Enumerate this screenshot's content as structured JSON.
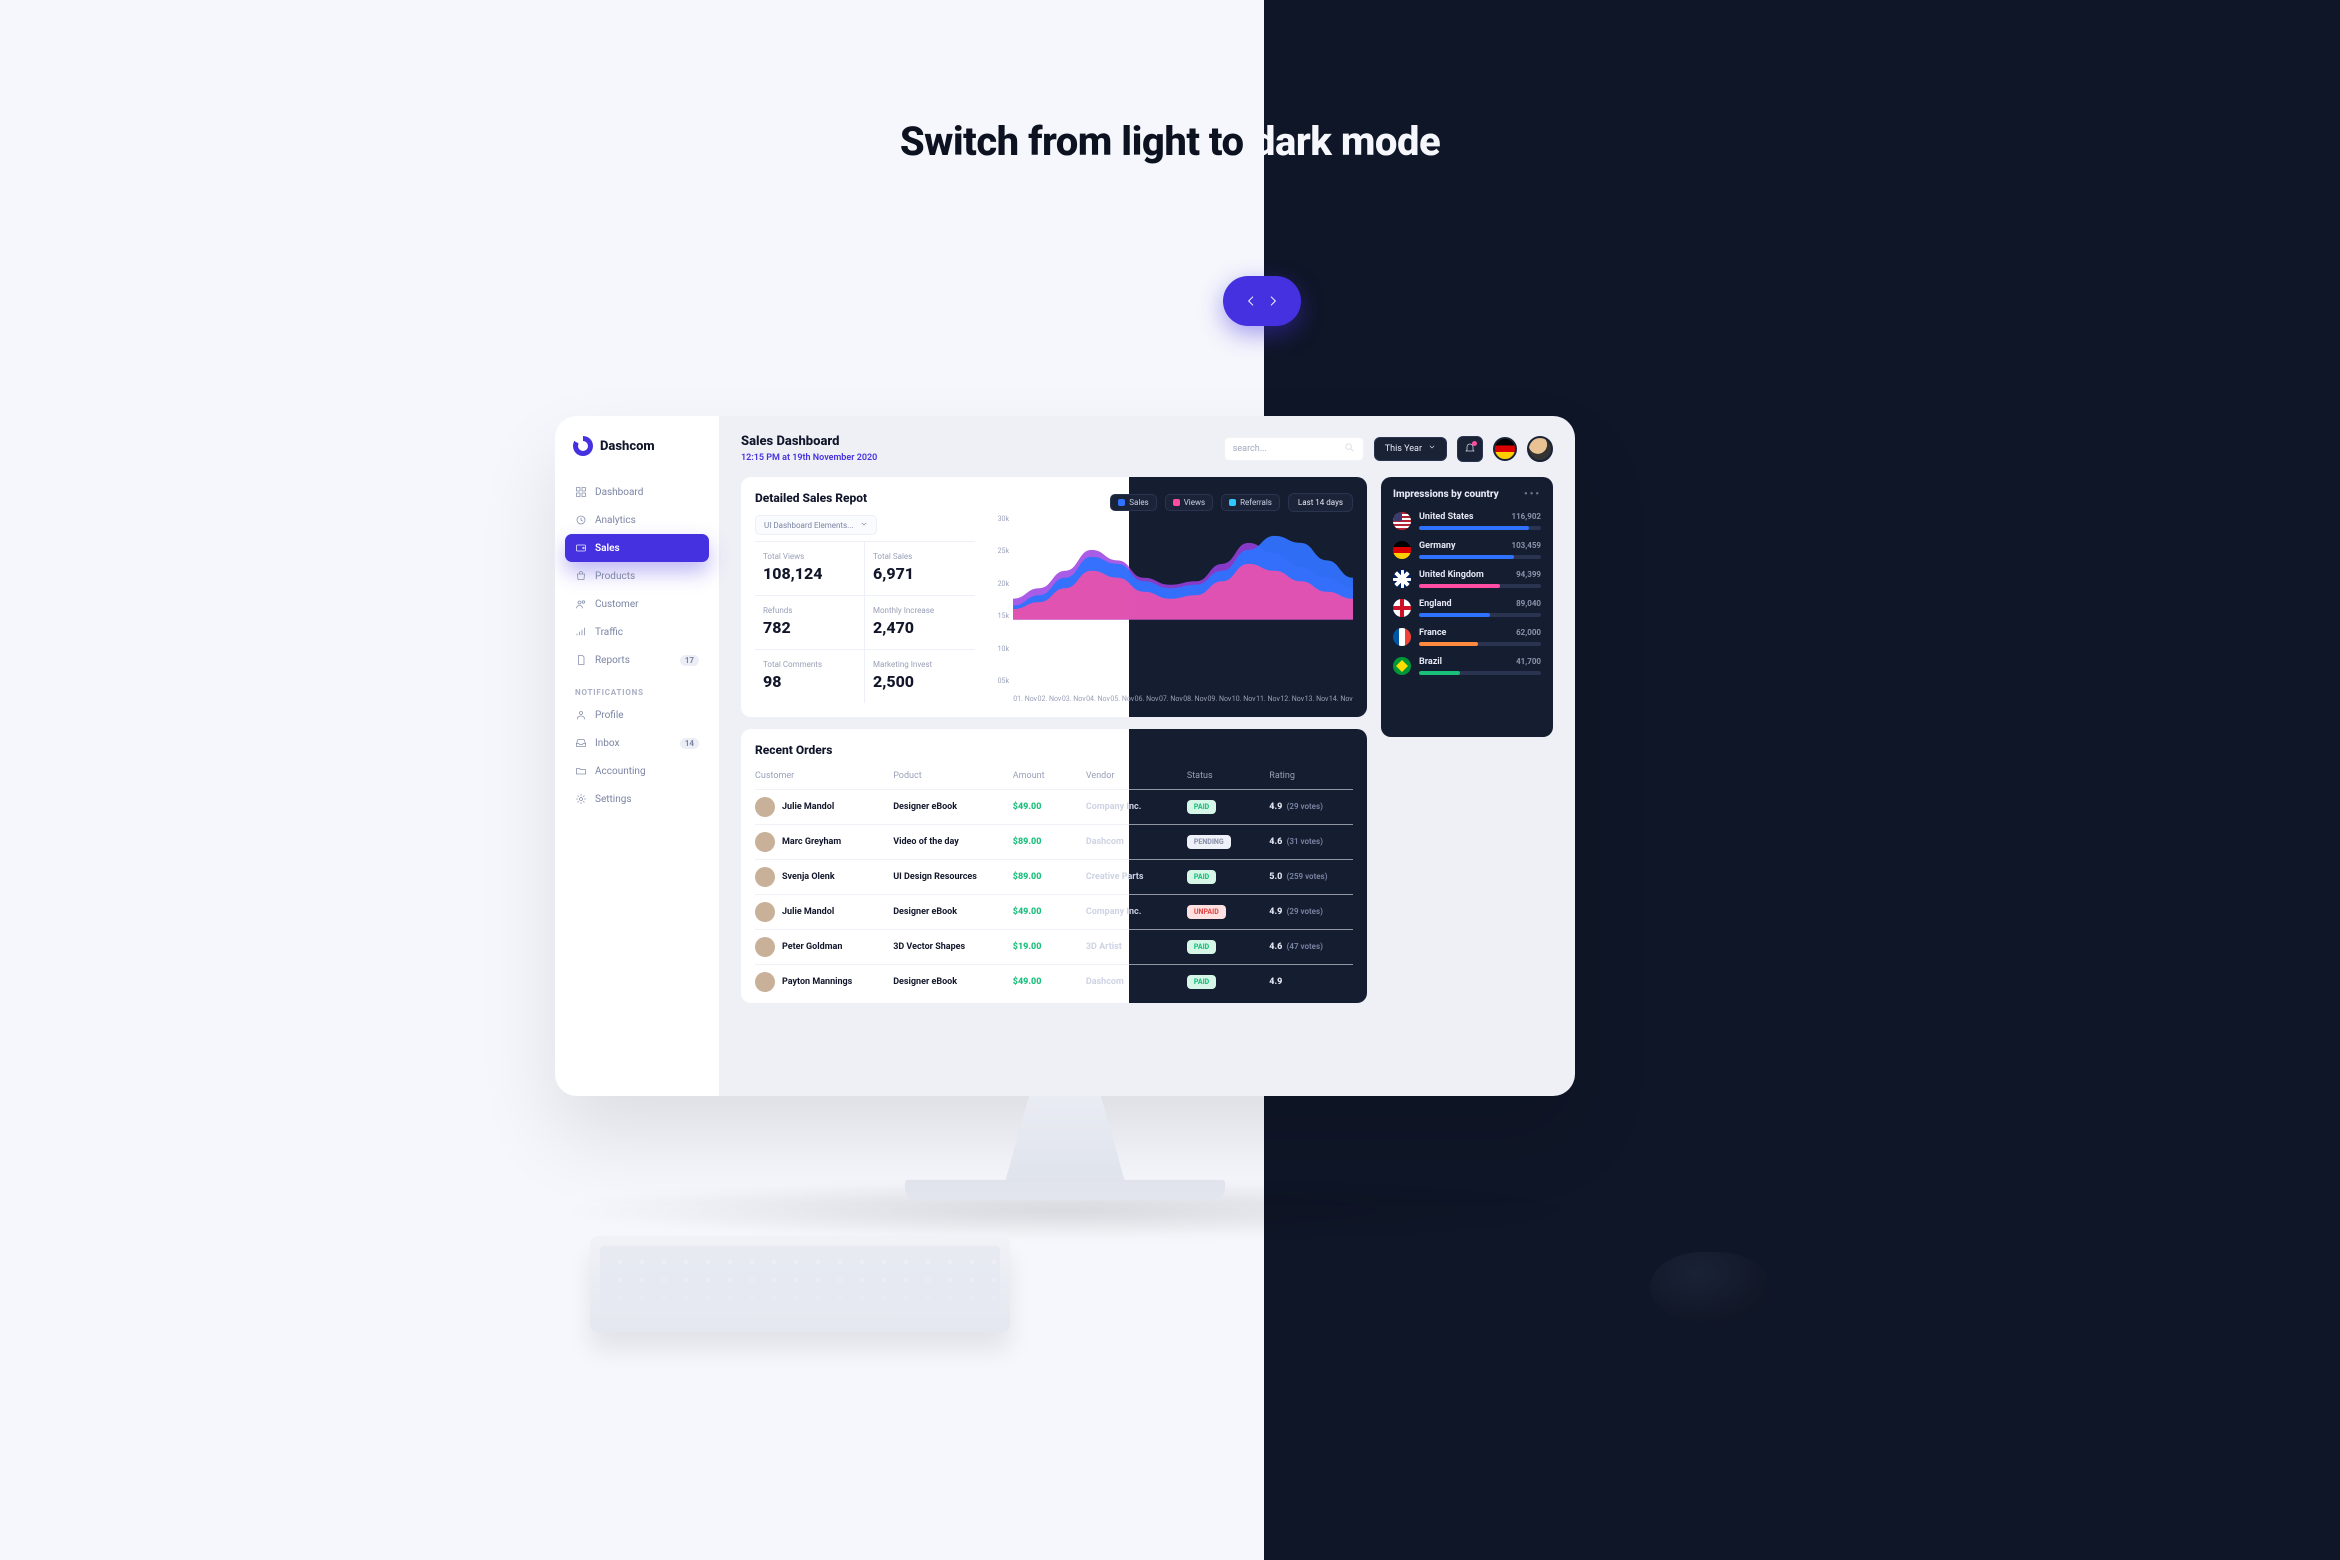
{
  "headline": {
    "light": "Switch from light to ",
    "dark": "dark mode"
  },
  "brand": {
    "name": "Dashcom"
  },
  "sidebar": {
    "items": [
      {
        "label": "Dashboard"
      },
      {
        "label": "Analytics"
      },
      {
        "label": "Sales"
      },
      {
        "label": "Products"
      },
      {
        "label": "Customer"
      },
      {
        "label": "Traffic"
      },
      {
        "label": "Reports",
        "badge": "17"
      }
    ],
    "section_label": "NOTIFICATIONS",
    "notif_items": [
      {
        "label": "Profile"
      },
      {
        "label": "Inbox",
        "badge": "14"
      },
      {
        "label": "Accounting"
      },
      {
        "label": "Settings"
      }
    ]
  },
  "topbar": {
    "title": "Sales Dashboard",
    "subtitle": "12:15 PM at 19th November 2020",
    "search_placeholder": "search...",
    "range_btn": "This Year"
  },
  "detailed": {
    "title": "Detailed Sales Repot",
    "dropdown": "UI Dashboard Elements...",
    "stats": [
      {
        "label": "Total Views",
        "value": "108,124"
      },
      {
        "label": "Total Sales",
        "value": "6,971"
      },
      {
        "label": "Refunds",
        "value": "782"
      },
      {
        "label": "Monthly Increase",
        "value": "2,470"
      },
      {
        "label": "Total Comments",
        "value": "98"
      },
      {
        "label": "Marketing Invest",
        "value": "2,500"
      }
    ],
    "legend": {
      "a": "Sales",
      "b": "Views",
      "c": "Referrals",
      "range": "Last 14 days"
    }
  },
  "chart_data": {
    "type": "area",
    "title": "Detailed Sales Repot",
    "ylabel": "",
    "xlabel": "",
    "ylim": [
      0,
      30
    ],
    "y_ticks": [
      "30k",
      "25k",
      "20k",
      "15k",
      "10k",
      "05k"
    ],
    "categories": [
      "01. Nov",
      "02. Nov",
      "03. Nov",
      "04. Nov",
      "05. Nov",
      "06. Nov",
      "07. Nov",
      "08. Nov",
      "09. Nov",
      "10. Nov",
      "11. Nov",
      "12. Nov",
      "13. Nov",
      "14. Nov"
    ],
    "series": [
      {
        "name": "Sales",
        "color": "#2f72ff",
        "values": [
          4,
          7,
          12,
          18,
          16,
          11,
          9,
          10,
          14,
          20,
          24,
          22,
          17,
          12
        ]
      },
      {
        "name": "Views",
        "color": "#9a3fe0",
        "values": [
          6,
          9,
          14,
          20,
          17,
          12,
          10,
          11,
          16,
          22,
          19,
          15,
          12,
          9
        ]
      },
      {
        "name": "Referrals",
        "color": "#ff4da3",
        "values": [
          3,
          5,
          9,
          14,
          12,
          8,
          6,
          7,
          11,
          16,
          14,
          11,
          8,
          6
        ]
      }
    ]
  },
  "orders": {
    "title": "Recent Orders",
    "columns": [
      "Customer",
      "Poduct",
      "Amount",
      "Vendor",
      "Status",
      "Rating"
    ],
    "rows": [
      {
        "customer": "Julie Mandol",
        "product": "Designer eBook",
        "amount": "$49.00",
        "vendor": "Company Inc.",
        "status": "PAID",
        "status_kind": "paid",
        "rating": "4.9",
        "votes": "(29 votes)"
      },
      {
        "customer": "Marc Greyham",
        "product": "Video of the day",
        "amount": "$89.00",
        "vendor": "Dashcom",
        "status": "PENDING",
        "status_kind": "pending",
        "rating": "4.6",
        "votes": "(31 votes)"
      },
      {
        "customer": "Svenja Olenk",
        "product": "UI Design Resources",
        "amount": "$89.00",
        "vendor": "Creative Parts",
        "status": "PAID",
        "status_kind": "paid",
        "rating": "5.0",
        "votes": "(259 votes)"
      },
      {
        "customer": "Julie Mandol",
        "product": "Designer eBook",
        "amount": "$49.00",
        "vendor": "Company Inc.",
        "status": "UNPAID",
        "status_kind": "unpaid",
        "rating": "4.9",
        "votes": "(29 votes)"
      },
      {
        "customer": "Peter Goldman",
        "product": "3D Vector Shapes",
        "amount": "$19.00",
        "vendor": "3D Artist",
        "status": "PAID",
        "status_kind": "paid",
        "rating": "4.6",
        "votes": "(47 votes)"
      },
      {
        "customer": "Payton Mannings",
        "product": "Designer eBook",
        "amount": "$49.00",
        "vendor": "Dashcom",
        "status": "PAID",
        "status_kind": "paid",
        "rating": "4.9",
        "votes": ""
      }
    ]
  },
  "impressions": {
    "title": "Impressions by country",
    "rows": [
      {
        "name": "United States",
        "value": "116,902",
        "pct": 90,
        "color": "#2f72ff",
        "flag": "us"
      },
      {
        "name": "Germany",
        "value": "103,459",
        "pct": 78,
        "color": "#2f72ff",
        "flag": "de"
      },
      {
        "name": "United Kingdom",
        "value": "94,399",
        "pct": 66,
        "color": "#ff4da3",
        "flag": "uk"
      },
      {
        "name": "England",
        "value": "89,040",
        "pct": 58,
        "color": "#2f72ff",
        "flag": "en"
      },
      {
        "name": "France",
        "value": "62,000",
        "pct": 48,
        "color": "#ff8a3d",
        "flag": "fr"
      },
      {
        "name": "Brazil",
        "value": "41,700",
        "pct": 34,
        "color": "#18c07a",
        "flag": "br"
      }
    ]
  }
}
